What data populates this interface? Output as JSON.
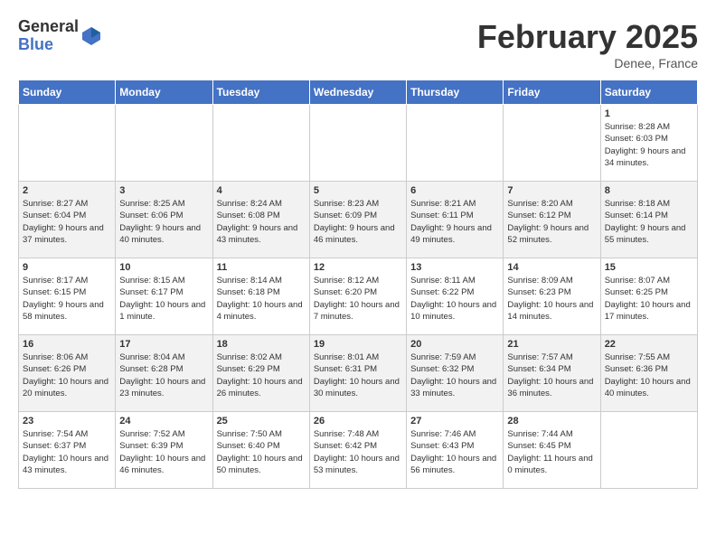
{
  "logo": {
    "general": "General",
    "blue": "Blue"
  },
  "title": "February 2025",
  "location": "Denee, France",
  "days_of_week": [
    "Sunday",
    "Monday",
    "Tuesday",
    "Wednesday",
    "Thursday",
    "Friday",
    "Saturday"
  ],
  "weeks": [
    [
      {
        "day": "",
        "info": ""
      },
      {
        "day": "",
        "info": ""
      },
      {
        "day": "",
        "info": ""
      },
      {
        "day": "",
        "info": ""
      },
      {
        "day": "",
        "info": ""
      },
      {
        "day": "",
        "info": ""
      },
      {
        "day": "1",
        "info": "Sunrise: 8:28 AM\nSunset: 6:03 PM\nDaylight: 9 hours and 34 minutes."
      }
    ],
    [
      {
        "day": "2",
        "info": "Sunrise: 8:27 AM\nSunset: 6:04 PM\nDaylight: 9 hours and 37 minutes."
      },
      {
        "day": "3",
        "info": "Sunrise: 8:25 AM\nSunset: 6:06 PM\nDaylight: 9 hours and 40 minutes."
      },
      {
        "day": "4",
        "info": "Sunrise: 8:24 AM\nSunset: 6:08 PM\nDaylight: 9 hours and 43 minutes."
      },
      {
        "day": "5",
        "info": "Sunrise: 8:23 AM\nSunset: 6:09 PM\nDaylight: 9 hours and 46 minutes."
      },
      {
        "day": "6",
        "info": "Sunrise: 8:21 AM\nSunset: 6:11 PM\nDaylight: 9 hours and 49 minutes."
      },
      {
        "day": "7",
        "info": "Sunrise: 8:20 AM\nSunset: 6:12 PM\nDaylight: 9 hours and 52 minutes."
      },
      {
        "day": "8",
        "info": "Sunrise: 8:18 AM\nSunset: 6:14 PM\nDaylight: 9 hours and 55 minutes."
      }
    ],
    [
      {
        "day": "9",
        "info": "Sunrise: 8:17 AM\nSunset: 6:15 PM\nDaylight: 9 hours and 58 minutes."
      },
      {
        "day": "10",
        "info": "Sunrise: 8:15 AM\nSunset: 6:17 PM\nDaylight: 10 hours and 1 minute."
      },
      {
        "day": "11",
        "info": "Sunrise: 8:14 AM\nSunset: 6:18 PM\nDaylight: 10 hours and 4 minutes."
      },
      {
        "day": "12",
        "info": "Sunrise: 8:12 AM\nSunset: 6:20 PM\nDaylight: 10 hours and 7 minutes."
      },
      {
        "day": "13",
        "info": "Sunrise: 8:11 AM\nSunset: 6:22 PM\nDaylight: 10 hours and 10 minutes."
      },
      {
        "day": "14",
        "info": "Sunrise: 8:09 AM\nSunset: 6:23 PM\nDaylight: 10 hours and 14 minutes."
      },
      {
        "day": "15",
        "info": "Sunrise: 8:07 AM\nSunset: 6:25 PM\nDaylight: 10 hours and 17 minutes."
      }
    ],
    [
      {
        "day": "16",
        "info": "Sunrise: 8:06 AM\nSunset: 6:26 PM\nDaylight: 10 hours and 20 minutes."
      },
      {
        "day": "17",
        "info": "Sunrise: 8:04 AM\nSunset: 6:28 PM\nDaylight: 10 hours and 23 minutes."
      },
      {
        "day": "18",
        "info": "Sunrise: 8:02 AM\nSunset: 6:29 PM\nDaylight: 10 hours and 26 minutes."
      },
      {
        "day": "19",
        "info": "Sunrise: 8:01 AM\nSunset: 6:31 PM\nDaylight: 10 hours and 30 minutes."
      },
      {
        "day": "20",
        "info": "Sunrise: 7:59 AM\nSunset: 6:32 PM\nDaylight: 10 hours and 33 minutes."
      },
      {
        "day": "21",
        "info": "Sunrise: 7:57 AM\nSunset: 6:34 PM\nDaylight: 10 hours and 36 minutes."
      },
      {
        "day": "22",
        "info": "Sunrise: 7:55 AM\nSunset: 6:36 PM\nDaylight: 10 hours and 40 minutes."
      }
    ],
    [
      {
        "day": "23",
        "info": "Sunrise: 7:54 AM\nSunset: 6:37 PM\nDaylight: 10 hours and 43 minutes."
      },
      {
        "day": "24",
        "info": "Sunrise: 7:52 AM\nSunset: 6:39 PM\nDaylight: 10 hours and 46 minutes."
      },
      {
        "day": "25",
        "info": "Sunrise: 7:50 AM\nSunset: 6:40 PM\nDaylight: 10 hours and 50 minutes."
      },
      {
        "day": "26",
        "info": "Sunrise: 7:48 AM\nSunset: 6:42 PM\nDaylight: 10 hours and 53 minutes."
      },
      {
        "day": "27",
        "info": "Sunrise: 7:46 AM\nSunset: 6:43 PM\nDaylight: 10 hours and 56 minutes."
      },
      {
        "day": "28",
        "info": "Sunrise: 7:44 AM\nSunset: 6:45 PM\nDaylight: 11 hours and 0 minutes."
      },
      {
        "day": "",
        "info": ""
      }
    ]
  ]
}
